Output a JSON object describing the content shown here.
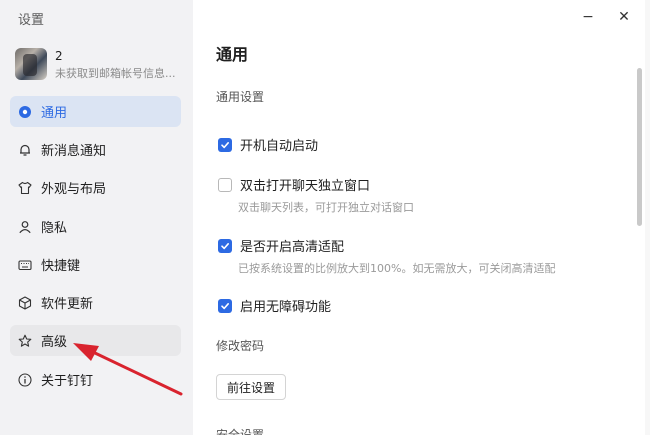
{
  "sidebar": {
    "title": "设置",
    "profile": {
      "name": "2",
      "subtitle": "未获取到邮箱帐号信息..."
    },
    "items": [
      {
        "label": "通用",
        "icon": "general-icon"
      },
      {
        "label": "新消息通知",
        "icon": "bell-icon"
      },
      {
        "label": "外观与布局",
        "icon": "shirt-icon"
      },
      {
        "label": "隐私",
        "icon": "person-icon"
      },
      {
        "label": "快捷键",
        "icon": "keyboard-icon"
      },
      {
        "label": "软件更新",
        "icon": "cube-icon"
      },
      {
        "label": "高级",
        "icon": "star-icon"
      },
      {
        "label": "关于钉钉",
        "icon": "info-icon"
      }
    ]
  },
  "window": {
    "minimize": "−",
    "close": "✕"
  },
  "main": {
    "title": "通用",
    "section_general": "通用设置",
    "options": [
      {
        "label": "开机自动启动",
        "checked": true,
        "desc": ""
      },
      {
        "label": "双击打开聊天独立窗口",
        "checked": false,
        "desc": "双击聊天列表，可打开独立对话窗口"
      },
      {
        "label": "是否开启高清适配",
        "checked": true,
        "desc": "已按系统设置的比例放大到100%。如无需放大，可关闭高清适配"
      },
      {
        "label": "启用无障碍功能",
        "checked": true,
        "desc": ""
      }
    ],
    "section_password": "修改密码",
    "goto_button": "前往设置",
    "section_security": "安全设置"
  },
  "colors": {
    "accent": "#2d6ae3",
    "sidebar_bg": "#f2f2f4",
    "active_bg": "#dbe4f3",
    "arrow": "#d9232e"
  }
}
